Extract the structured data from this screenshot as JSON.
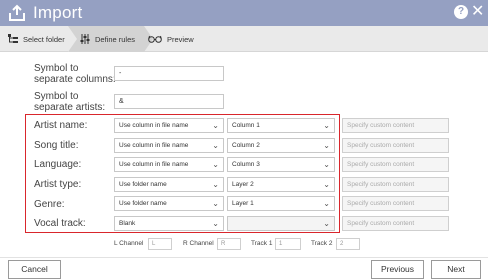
{
  "window": {
    "title": "Import",
    "help_label": "?",
    "close_label": "✕"
  },
  "steps": [
    {
      "label": "Select folder"
    },
    {
      "label": "Define rules"
    },
    {
      "label": "Preview"
    }
  ],
  "separators": {
    "columns_label_line1": "Symbol to",
    "columns_label_line2": "separate columns:",
    "columns_value": "-",
    "artists_label_line1": "Symbol to",
    "artists_label_line2": "separate artists:",
    "artists_value": "&"
  },
  "rules": [
    {
      "label": "Artist name:",
      "source": "Use column in file name",
      "target": "Column 1",
      "custom_placeholder": "Specify custom content"
    },
    {
      "label": "Song title:",
      "source": "Use column in file name",
      "target": "Column 2",
      "custom_placeholder": "Specify custom content"
    },
    {
      "label": "Language:",
      "source": "Use column in file name",
      "target": "Column 3",
      "custom_placeholder": "Specify custom content"
    },
    {
      "label": "Artist type:",
      "source": "Use folder name",
      "target": "Layer 2",
      "custom_placeholder": "Specify custom content"
    },
    {
      "label": "Genre:",
      "source": "Use folder name",
      "target": "Layer 1",
      "custom_placeholder": "Specify custom content"
    },
    {
      "label": "Vocal track:",
      "source": "Blank",
      "target": "",
      "custom_placeholder": "Specify custom content"
    }
  ],
  "channels": {
    "l_channel_label": "L Channel",
    "l_channel_value": "L",
    "r_channel_label": "R Channel",
    "r_channel_value": "R",
    "track1_label": "Track 1",
    "track1_value": "1",
    "track2_label": "Track 2",
    "track2_value": "2"
  },
  "footer": {
    "cancel_label": "Cancel",
    "previous_label": "Previous",
    "next_label": "Next"
  },
  "colors": {
    "titlebar": "#95a0c2",
    "highlight": "#d9262c"
  }
}
